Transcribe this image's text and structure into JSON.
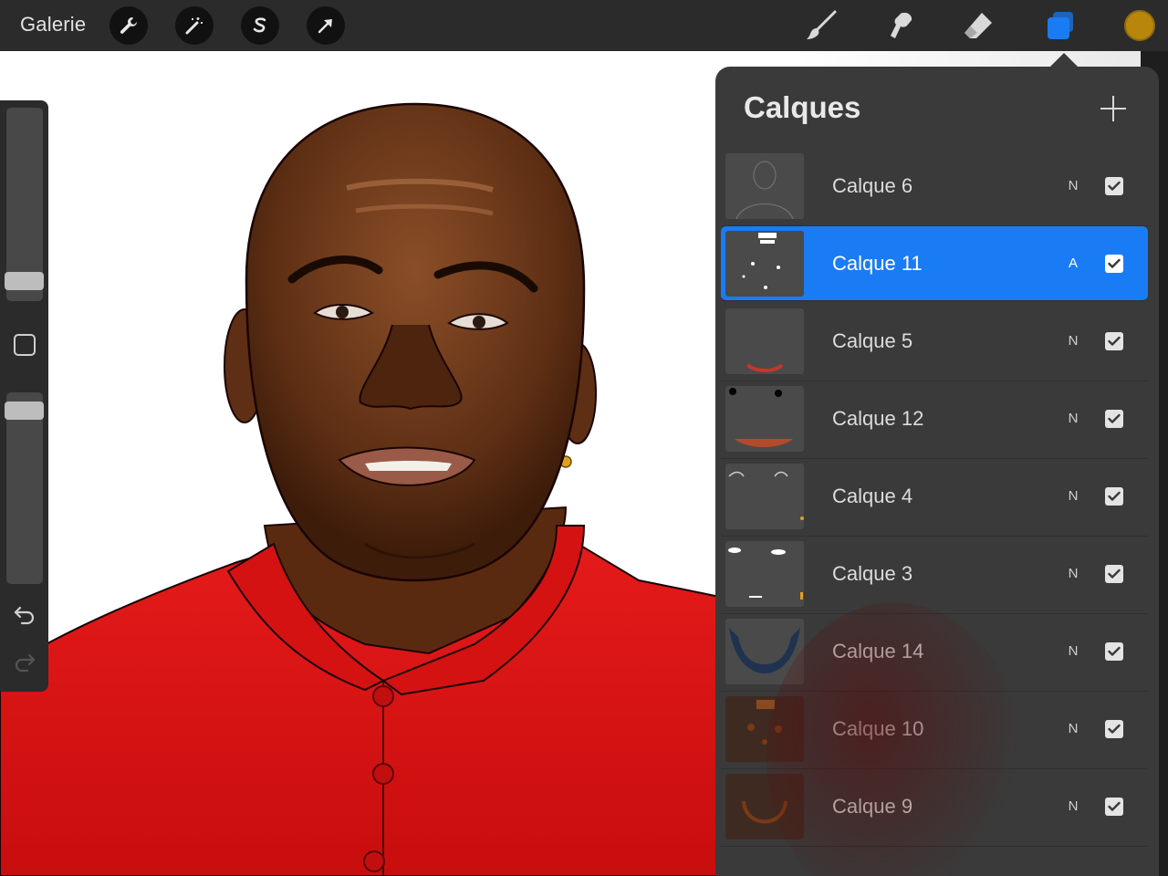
{
  "toolbar": {
    "gallery_label": "Galerie",
    "left_tools": [
      "wrench-icon",
      "magic-wand-icon",
      "selection-s-icon",
      "arrow-transform-icon"
    ],
    "right_tools": [
      "brush-icon",
      "smudge-icon",
      "eraser-icon",
      "layers-icon"
    ],
    "active_tool": "layers-icon",
    "active_tool_color": "#1a7cf5",
    "current_color": "#b8860b"
  },
  "sidebar": {
    "brush_size_level": 0.06,
    "opacity_level": 0.95,
    "icons": [
      "modify-square-icon",
      "undo-icon",
      "redo-icon"
    ]
  },
  "layers_panel": {
    "title": "Calques",
    "add_icon": "plus-icon",
    "selected_color": "#1a7cf5",
    "layers": [
      {
        "name": "Calque 6",
        "blend": "N",
        "visible": true,
        "selected": false
      },
      {
        "name": "Calque 11",
        "blend": "A",
        "visible": true,
        "selected": true
      },
      {
        "name": "Calque 5",
        "blend": "N",
        "visible": true,
        "selected": false
      },
      {
        "name": "Calque 12",
        "blend": "N",
        "visible": true,
        "selected": false
      },
      {
        "name": "Calque 4",
        "blend": "N",
        "visible": true,
        "selected": false
      },
      {
        "name": "Calque 3",
        "blend": "N",
        "visible": true,
        "selected": false
      },
      {
        "name": "Calque 14",
        "blend": "N",
        "visible": true,
        "selected": false
      },
      {
        "name": "Calque 10",
        "blend": "N",
        "visible": true,
        "selected": false
      },
      {
        "name": "Calque 9",
        "blend": "N",
        "visible": true,
        "selected": false
      }
    ]
  },
  "canvas": {
    "shirt_color": "#e31414",
    "skin_color": "#6b3618"
  }
}
